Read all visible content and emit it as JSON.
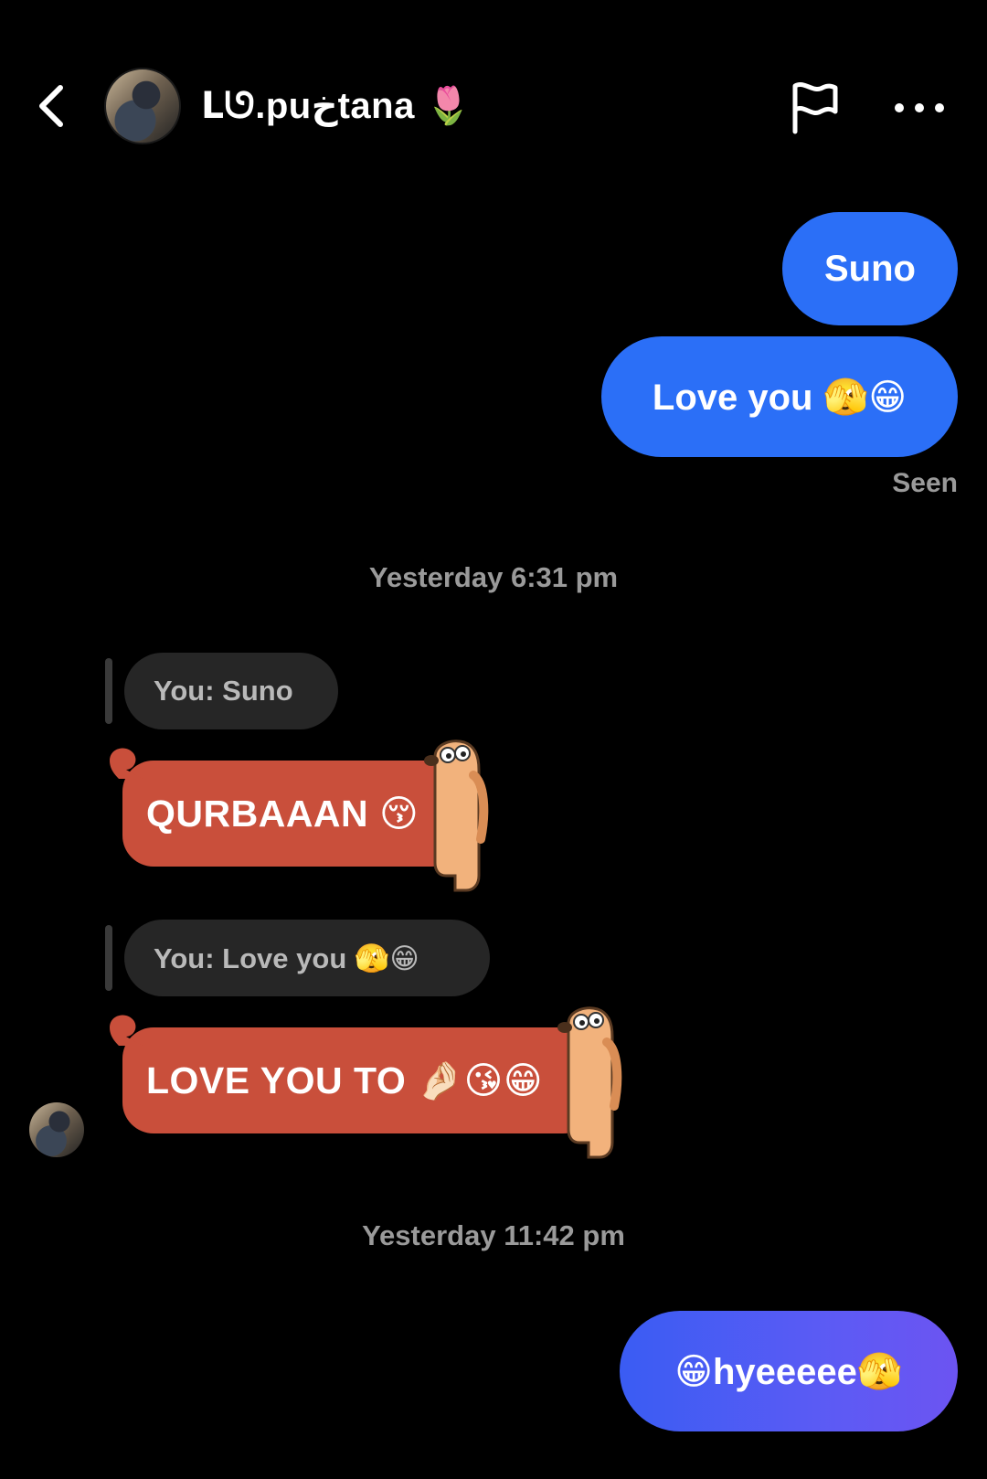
{
  "header": {
    "username": "ᒪᘎ.puخtana 🌷",
    "back_icon": "chevron-left-icon",
    "flag_icon": "flag-icon",
    "more_icon": "more-horizontal-icon"
  },
  "messages": {
    "sent_1": "Suno",
    "sent_2": "Love you 🫣😁",
    "seen": "Seen",
    "timestamp_1": "Yesterday 6:31 pm",
    "reply_1": "You: Suno",
    "received_1": "QURBAAAN 😚",
    "reply_2": "You: Love you 🫣😁",
    "received_2": "LOVE YOU TO 🤌🏻😘😁",
    "timestamp_2": "Yesterday 11:42 pm",
    "sent_3": "😁hyeeeee🫣"
  },
  "colors": {
    "sent_bubble": "#2b6ff7",
    "sent_gradient_end": "#6c54f2",
    "received_bubble": "#c94f3b",
    "reply_pill": "#262626",
    "background": "#000000"
  }
}
